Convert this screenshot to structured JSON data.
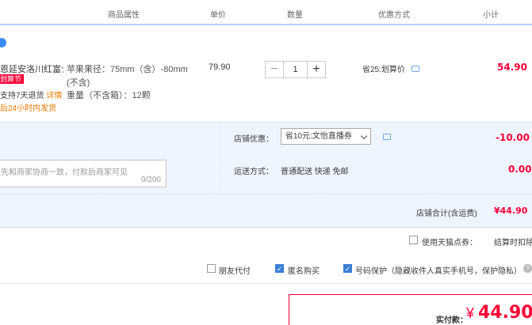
{
  "header": {
    "col_product_attr": "商品属性",
    "col_unit_price": "单价",
    "col_quantity": "数量",
    "col_discount": "优惠方式",
    "col_subtotal": "小计"
  },
  "item": {
    "title": "恩延安洛川红富士…",
    "promo_tag": "划算节",
    "service_1": "支持7天退货",
    "service_1_link": "详情",
    "service_2": "后24小时内发货",
    "attr_1": "苹果果径：75mm（含）-80mm",
    "attr_1b": "(不含)",
    "attr_2": "重量（不含箱）：12颗",
    "unit_price": "79.90",
    "quantity": "1",
    "minus": "−",
    "plus": "+",
    "discount": "省25:划算价",
    "subtotal": "54.90"
  },
  "shop": {
    "discount_label": "店铺优惠：",
    "discount_selected": "省10元:文怡直播券",
    "discount_amount": "-10.00",
    "shipping_label": "运送方式：",
    "shipping_value": "普通配送 快递 免邮",
    "shipping_amount": "0.00",
    "message_placeholder": "先和商家协商一致，付款后商家可见",
    "message_counter": "0/200",
    "total_label": "店铺合计(含运费)",
    "total_value": "¥44.90"
  },
  "options": {
    "tmall_points": "使用天猫点券：",
    "settle_text": "结算时扣除",
    "friend_pay": "朋友代付",
    "anonymous": "匿名购买",
    "privacy": "号码保护（隐藏收件人真实手机号，保护隐私）",
    "anonymous_checked": true,
    "privacy_checked": true,
    "friend_pay_checked": false,
    "tmall_points_checked": false
  },
  "payment": {
    "label": "实付款：",
    "currency": "¥",
    "amount": "44.90"
  },
  "colors": {
    "accent_red": "#ff0036",
    "panel_blue": "#eef5ff",
    "checkbox_blue": "#3b7ed6"
  }
}
